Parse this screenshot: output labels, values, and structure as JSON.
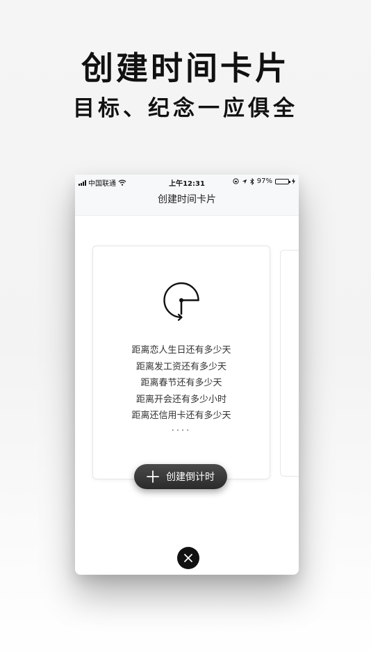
{
  "promo": {
    "headline": "创建时间卡片",
    "subheadline": "目标、纪念一应俱全"
  },
  "status_bar": {
    "carrier": "中国联通",
    "time": "上午12:31",
    "battery_percent": "97%",
    "battery_level": 0.97,
    "icons": [
      "signal-icon",
      "wifi-icon",
      "lock-rotation-icon",
      "location-icon",
      "bluetooth-icon",
      "battery-icon",
      "charging-icon"
    ]
  },
  "nav": {
    "title": "创建时间卡片"
  },
  "card": {
    "icon": "clock-icon",
    "lines": [
      "距离恋人生日还有多少天",
      "距离发工资还有多少天",
      "距离春节还有多少天",
      "距离开会还有多少小时",
      "距离还信用卡还有多少天"
    ],
    "ellipsis": "····"
  },
  "create_button": {
    "icon": "plus-icon",
    "label": "创建倒计时"
  },
  "close_button": {
    "icon": "close-icon"
  },
  "colors": {
    "accent_dark": "#2b2b2b",
    "battery_green": "#4cd964",
    "nav_bg": "#f7f8fa"
  }
}
